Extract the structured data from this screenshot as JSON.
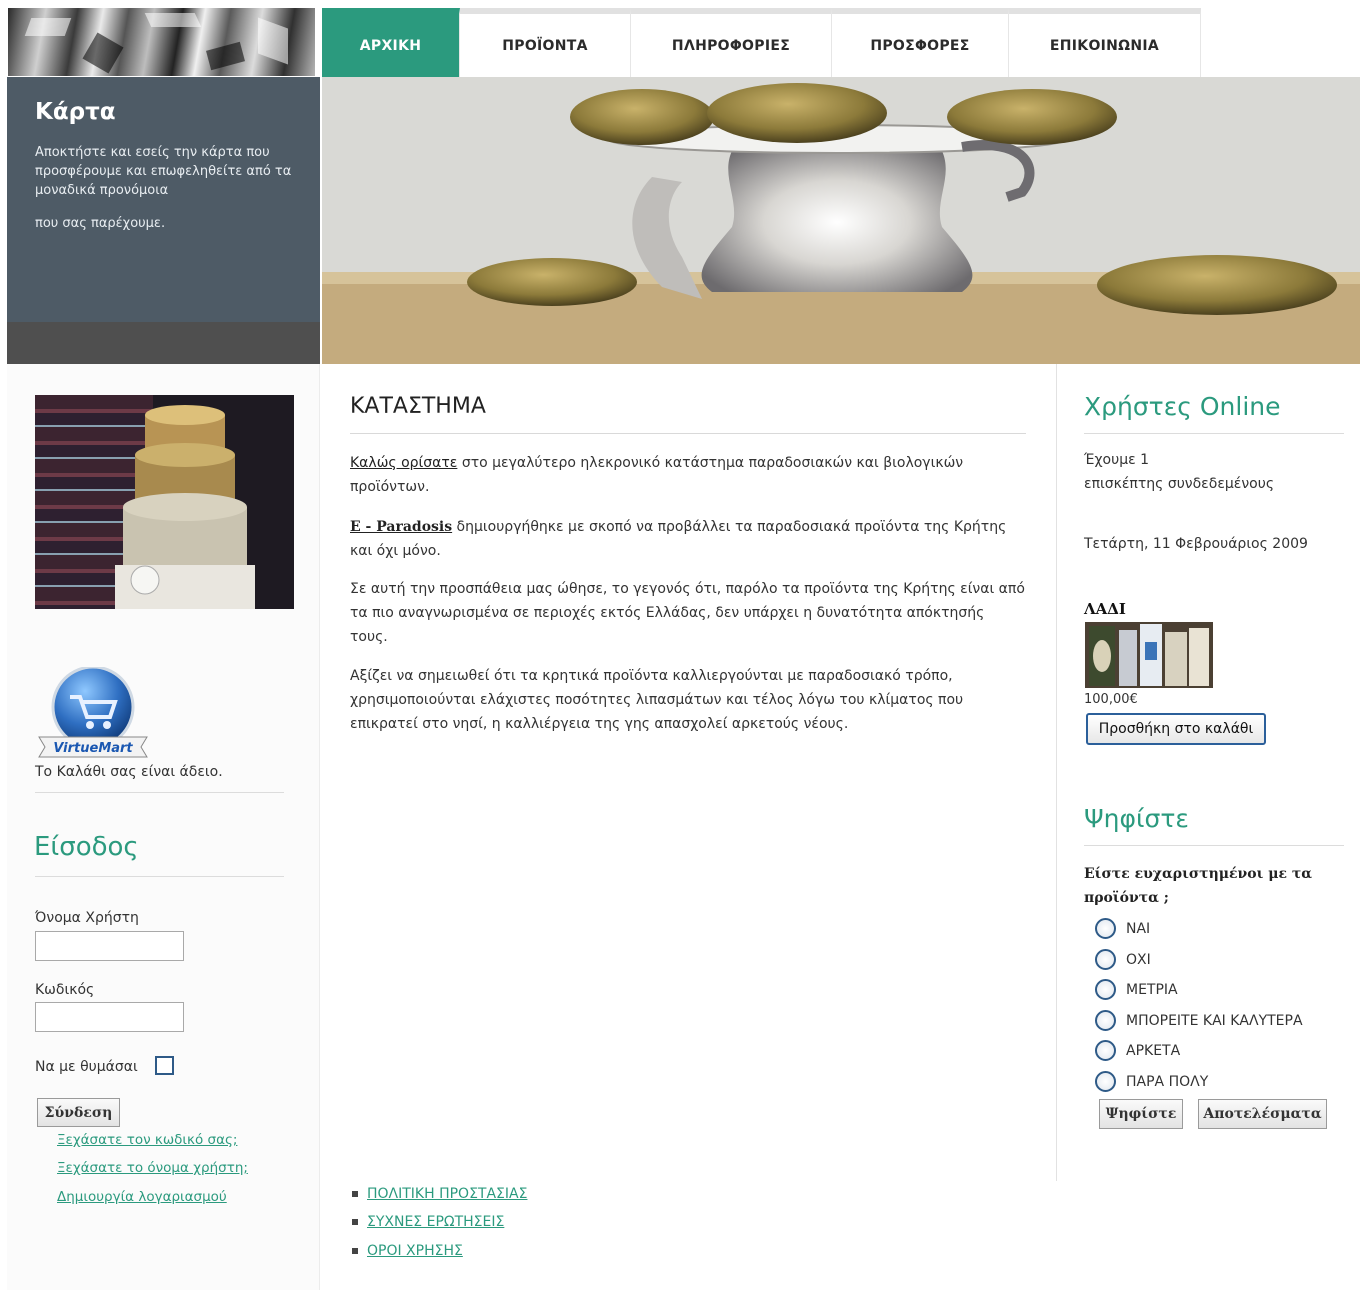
{
  "nav": {
    "tabs": [
      {
        "label": "ΑΡΧΙΚΗ",
        "active": true
      },
      {
        "label": "ΠΡΟΪΟΝΤΑ",
        "active": false
      },
      {
        "label": "ΠΛΗΡΟΦΟΡΙΕΣ",
        "active": false
      },
      {
        "label": "ΠΡΟΣΦΟΡΕΣ",
        "active": false
      },
      {
        "label": "ΕΠΙΚΟΙΝΩΝΙΑ",
        "active": false
      }
    ]
  },
  "card": {
    "title": "Κάρτα",
    "text1": "Αποκτήστε και εσείς την κάρτα που προσφέρουμε και επωφεληθείτε από τα μοναδικά προνόμοια",
    "text2": "που σας παρέχουμε."
  },
  "left": {
    "vm_logo_text": "VirtueMart",
    "cart_empty": "Το Καλάθι σας είναι άδειο.",
    "login": {
      "title": "Είσοδος",
      "username_label": "Όνομα Χρήστη",
      "username_value": "",
      "password_label": "Κωδικός",
      "password_value": "",
      "remember_label": "Να με θυμάσαι",
      "remember_checked": false,
      "submit": "Σύνδεση",
      "links": [
        "Ξεχάσατε τον κωδικό σας;",
        "Ξεχάσατε το όνομα χρήστη;",
        "Δημιουργία λογαριασμού"
      ]
    }
  },
  "main": {
    "title": "ΚΑΤΑΣΤΗΜΑ",
    "p1_link": "Καλώς ορίσατε",
    "p1_rest": " στο μεγαλύτερο ηλεκρονικό κατάστημα παραδοσιακών και βιολογικών προϊόντων.",
    "p2_link": " E - Paradosis",
    "p2_rest": " δημιουργήθηκε με σκοπό να προβάλλει τα παραδοσιακά προϊόντα της Κρήτης και όχι μόνο.",
    "p3": "Σε αυτή την προσπάθεια μας ώθησε, το γεγονός ότι, παρόλο τα προϊόντα της Κρήτης είναι από τα πιο αναγνωρισμένα σε περιοχές εκτός Ελλάδας, δεν υπάρχει η δυνατότητα απόκτησής τους.",
    "p4": "Αξίζει να σημειωθεί ότι τα κρητικά προϊόντα καλλιεργούνται με παραδοσιακό τρόπο, χρησιμοποιούνται ελάχιστες ποσότητες λιπασμάτων και τέλος λόγω του κλίματος που επικρατεί στο νησί, η καλλιέργεια της γης απασχολεί αρκετούς νέους.",
    "footer_links": [
      "ΠΟΛΙΤΙΚΗ ΠΡΟΣΤΑΣΙΑΣ",
      "ΣΥΧΝΕΣ ΕΡΩΤΗΣΕΙΣ",
      "ΟΡΟΙ ΧΡΗΣΗΣ"
    ]
  },
  "right": {
    "online_title": "Χρήστες Online",
    "online_line1": "Έχουμε 1",
    "online_line2": "επισκέπτης συνδεδεμένους",
    "date": "Τετάρτη, 11 Φεβρουάριος 2009",
    "product": {
      "name": "ΛΑΔΙ",
      "price": "100,00€",
      "button": "Προσθήκη στο καλάθι"
    },
    "poll": {
      "title": "Ψηφίστε",
      "question": "Είστε ευχαριστημένοι με τα προϊόντα ;",
      "options": [
        "ΝΑΙ",
        "ΟΧΙ",
        "ΜΕΤΡΙΑ",
        "ΜΠΟΡΕΙΤΕ ΚΑΙ ΚΑΛΥΤΕΡΑ",
        "ΑΡΚΕΤΑ",
        "ΠΑΡΑ ΠΟΛΥ"
      ],
      "vote_button": "Ψηφίστε",
      "results_button": "Αποτελέσματα"
    }
  },
  "colors": {
    "accent": "#2b9a7e",
    "card_bg": "#4e5b66",
    "radio_border": "#2e5a87"
  }
}
